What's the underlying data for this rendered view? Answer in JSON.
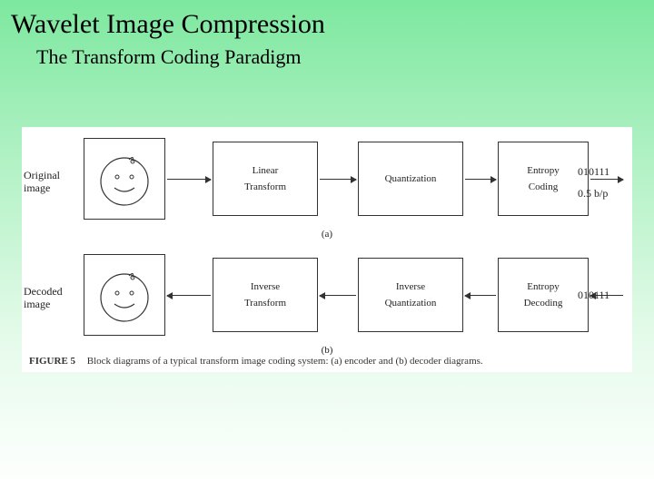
{
  "title": "Wavelet Image Compression",
  "subtitle": "The Transform Coding Paradigm",
  "row_a": {
    "left_label": "Original image",
    "box1_l1": "Linear",
    "box1_l2": "Transform",
    "box2_l1": "Quantization",
    "box3_l1": "Entropy",
    "box3_l2": "Coding",
    "right_l1": "010111",
    "right_l2": "0.5 b/p",
    "tag": "(a)"
  },
  "row_b": {
    "left_label": "Decoded image",
    "box1_l1": "Inverse",
    "box1_l2": "Transform",
    "box2_l1": "Inverse",
    "box2_l2": "Quantization",
    "box3_l1": "Entropy",
    "box3_l2": "Decoding",
    "right_l1": "010111",
    "tag": "(b)"
  },
  "caption_num": "FIGURE 5",
  "caption_text": "Block diagrams of a typical transform image coding system: (a) encoder and (b) decoder diagrams."
}
